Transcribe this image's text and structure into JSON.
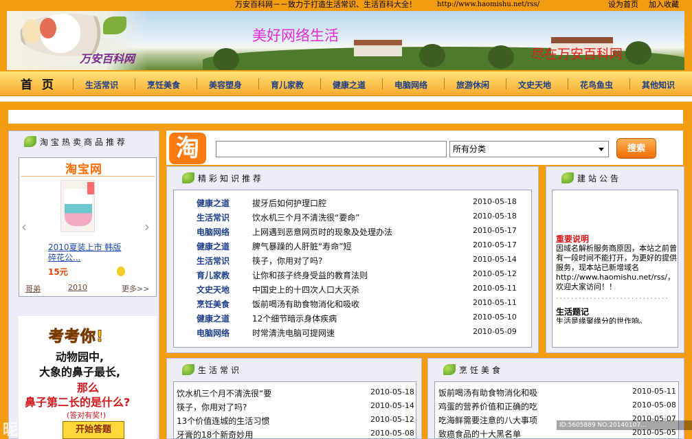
{
  "top": {
    "slogan": "万安百科网－－致力于打造生活常识、生活百科大全！",
    "url": "http://www.haomishu.net/rss/",
    "set_home": "设为首页",
    "add_fav": "加入收藏"
  },
  "banner": {
    "brand": "万安百科网",
    "motto": "美好网络生活",
    "slogan": "尽在万安百科网"
  },
  "nav": {
    "home": "首 页",
    "items": [
      "生活常识",
      "烹饪美食",
      "美容塑身",
      "育儿家教",
      "健康之道",
      "电脑网络",
      "旅游休闲",
      "文史天地",
      "花鸟鱼虫",
      "其他知识"
    ]
  },
  "taobao": {
    "panel_title": "淘宝热卖商品推荐",
    "logo_text": "淘宝网",
    "item_title": "2010夏装上市 韩版 碎花公...",
    "price": "15元",
    "footer_left": "哥弟",
    "footer_mid": "2010",
    "footer_more": "更多>>",
    "prev_icon": "‹",
    "next_icon": "›"
  },
  "ad": {
    "head": "考考你!",
    "line1": "动物园中,",
    "line2": "大象的鼻子最长,",
    "line3": "那么",
    "line4": "鼻子第二长的是什么?",
    "line5": "(答对有奖!)",
    "button": "开始答题"
  },
  "search": {
    "logo": "淘",
    "input_value": "",
    "category": "所有分类",
    "button": "搜索"
  },
  "featured": {
    "title": "精彩知识推荐",
    "rows": [
      {
        "cat": "健康之道",
        "title": "拔牙后如何护理口腔",
        "date": "2010-05-18"
      },
      {
        "cat": "生活常识",
        "title": "饮水机三个月不清洗很“要命”",
        "date": "2010-05-18"
      },
      {
        "cat": "电脑网络",
        "title": "上网遇到恶意网页时的现象及处理办法",
        "date": "2010-05-17"
      },
      {
        "cat": "健康之道",
        "title": "脾气暴躁的人肝脏“寿命”短",
        "date": "2010-05-17"
      },
      {
        "cat": "生活常识",
        "title": "筷子，你用对了吗?",
        "date": "2010-05-14"
      },
      {
        "cat": "育儿家教",
        "title": "让你和孩子终身受益的教育法则",
        "date": "2010-05-12"
      },
      {
        "cat": "文史天地",
        "title": "中国史上的十四次人口大灭杀",
        "date": "2010-05-11"
      },
      {
        "cat": "烹饪美食",
        "title": "饭前喝汤有助食物消化和吸收",
        "date": "2010-05-11"
      },
      {
        "cat": "健康之道",
        "title": "12个细节暗示身体疾病",
        "date": "2010-05-10"
      },
      {
        "cat": "电脑网络",
        "title": "时常清洗电脑可提网速",
        "date": "2010-05-09"
      }
    ]
  },
  "notice": {
    "title": "建站公告",
    "heading": "重要说明",
    "body": "因域名解析服务商原因，本站之前曾有一段时间不能打开，为更好的提供服务，现本站已新增域名http://www.haomishu.net/rss/，欢迎大家访问！！",
    "dots": "..............................",
    "heading2": "生活题记",
    "body2": "生活是缘聚缘分的世作响。"
  },
  "life": {
    "title": "生活常识",
    "rows": [
      {
        "title": "饮水机三个月不清洗很“要",
        "date": "2010-05-18"
      },
      {
        "title": "筷子，你用对了吗?",
        "date": "2010-05-14"
      },
      {
        "title": "13个价值连城的生活习惯",
        "date": "2010-05-12"
      },
      {
        "title": "牙膏的18个新奇妙用",
        "date": "2010-05-08"
      }
    ]
  },
  "cooking": {
    "title": "烹饪美食",
    "rows": [
      {
        "title": "饭前喝汤有助食物消化和吸",
        "date": "2010-05-11"
      },
      {
        "title": "鸡蛋的营养价值和正确的吃",
        "date": "2010-05-08"
      },
      {
        "title": "吃海鲜需要注意的八大事项",
        "date": "2010-05-07"
      },
      {
        "title": "致癌食品的十大黑名单",
        "date": "2010-05-05"
      }
    ]
  },
  "watermark": {
    "logo": "昵享网",
    "id": "ID:5605889 NO:20140107..."
  },
  "colors": {
    "orange": "#f39c12",
    "nav_text": "#1d3e8a",
    "panel_bg": "#ecedf6",
    "accent_red": "#d4161b"
  }
}
